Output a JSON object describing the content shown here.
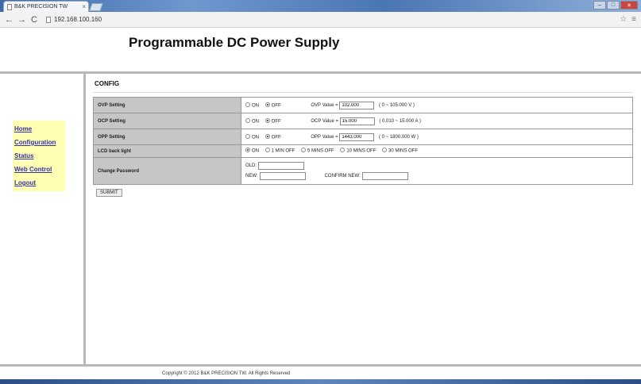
{
  "browser": {
    "tab_title": "B&K PRECISION TW",
    "tab_close": "×",
    "url": "192.168.100.160",
    "back_icon": "←",
    "forward_icon": "→",
    "reload_icon": "C",
    "star_icon": "☆",
    "menu_icon": "≡",
    "minimize": "–",
    "maximize": "□",
    "close": "✕"
  },
  "page": {
    "title": "Programmable DC Power Supply",
    "footer": "Copyright © 2012 B&K PRECISION TW. All Rights Reserved"
  },
  "sidebar": {
    "items": [
      {
        "label": "Home"
      },
      {
        "label": "Configuration"
      },
      {
        "label": "Status"
      },
      {
        "label": "Web Control"
      },
      {
        "label": "Logout"
      }
    ]
  },
  "config": {
    "heading": "CONFIG",
    "ovp": {
      "label": "OVP Setting",
      "on": "ON",
      "off": "OFF",
      "selected": "OFF",
      "value_label": "OVP Value =",
      "value": "102.000",
      "range": "( 0 ~ 105.000 V )"
    },
    "ocp": {
      "label": "OCP Setting",
      "on": "ON",
      "off": "OFF",
      "selected": "OFF",
      "value_label": "OCP Value =",
      "value": "15.000",
      "range": "( 0.010 ~ 15.000 A )"
    },
    "opp": {
      "label": "OPP Setting",
      "on": "ON",
      "off": "OFF",
      "selected": "OFF",
      "value_label": "OPP Value =",
      "value": "1443.000",
      "range": "( 0 ~ 1800.000 W )"
    },
    "lcd": {
      "label": "LCD back light",
      "selected": "ON",
      "options": [
        "ON",
        "1 MIN OFF",
        "5 MINS OFF",
        "10 MINS OFF",
        "30 MINS OFF"
      ]
    },
    "password": {
      "label": "Change Password",
      "old_label": "OLD:",
      "new_label": "NEW:",
      "confirm_label": "CONFIRM NEW:",
      "old_value": "",
      "new_value": "",
      "confirm_value": ""
    },
    "submit": "SUBMIT"
  },
  "colors": {
    "label_cell": "#c6c6c6",
    "sidebar_bg": "#ffffb3",
    "link": "#3333aa"
  }
}
